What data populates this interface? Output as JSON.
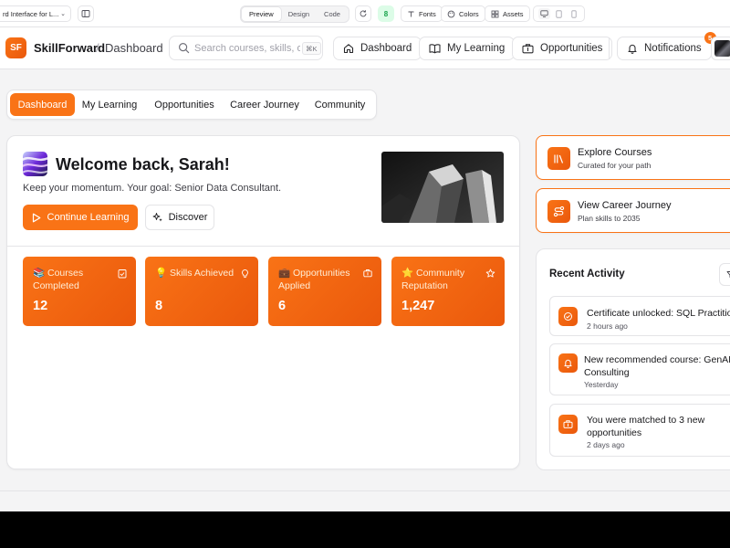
{
  "editor": {
    "project_name": "rd Interface for L...",
    "modes": [
      "Preview",
      "Design",
      "Code"
    ],
    "status_badge": "8",
    "fonts_label": "Fonts",
    "colors_label": "Colors",
    "assets_label": "Assets"
  },
  "header": {
    "logo": "SF",
    "brand": "SkillForward",
    "breadcrumb_sep": "/",
    "breadcrumb": "Dashboard",
    "search_placeholder": "Search courses, skills, o",
    "search_shortcut": "⌘K",
    "nav": {
      "dashboard": "Dashboard",
      "learning": "My Learning",
      "opportunities": "Opportunities",
      "notifications": "Notifications"
    },
    "notification_count": "5"
  },
  "tabs": [
    "Dashboard",
    "My Learning",
    "Opportunities",
    "Career Journey",
    "Community"
  ],
  "hero": {
    "welcome": "Welcome back, Sarah!",
    "goal": "Keep your momentum. Your goal: Senior Data Consultant.",
    "continue_label": "Continue Learning",
    "discover_label": "Discover"
  },
  "stats": [
    {
      "emoji": "📚",
      "label": "Courses Completed",
      "value": "12"
    },
    {
      "emoji": "💡",
      "label": "Skills Achieved",
      "value": "8"
    },
    {
      "emoji": "💼",
      "label": "Opportunities Applied",
      "value": "6"
    },
    {
      "emoji": "⭐",
      "label": "Community Reputation",
      "value": "1,247"
    }
  ],
  "quick_actions": [
    {
      "title": "Explore Courses",
      "subtitle": "Curated for your path"
    },
    {
      "title": "View Career Journey",
      "subtitle": "Plan skills to 2035"
    }
  ],
  "activity": {
    "title": "Recent Activity",
    "items": [
      {
        "line1": "Certificate unlocked: SQL Practitioner",
        "line2": "",
        "time": "2 hours ago"
      },
      {
        "line1": "New recommended course: GenAI for",
        "line2": "Consulting",
        "time": "Yesterday"
      },
      {
        "line1": "You were matched to 3 new",
        "line2": "opportunities",
        "time": "2 days ago"
      }
    ]
  },
  "colors": {
    "accent": "#f97316",
    "accent_dark": "#ea580c",
    "border": "#e4e4e7",
    "background": "#f4f4f5"
  }
}
